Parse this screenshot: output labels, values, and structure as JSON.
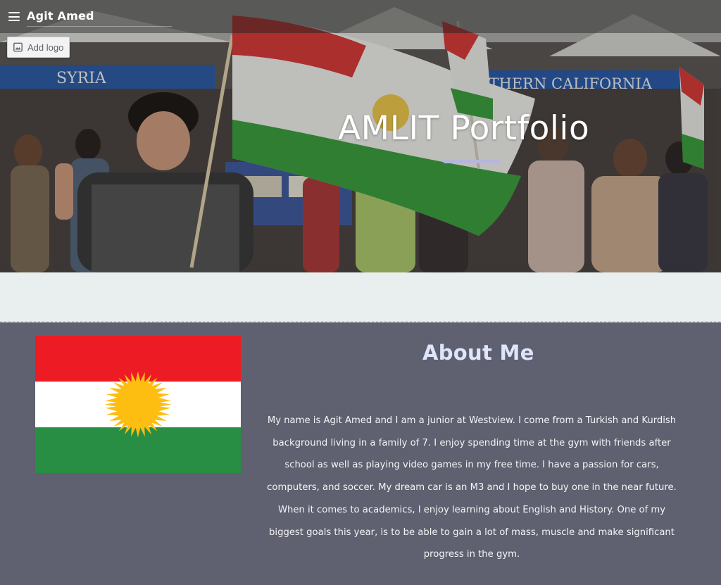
{
  "header": {
    "site_title": "Agit Amed",
    "add_logo_label": "Add logo"
  },
  "hero": {
    "title": "AMLIT Portfolio",
    "banner_left": "SYRIA",
    "banner_right": "COMMUNITY  SOUTHERN CALIFORNIA"
  },
  "about": {
    "heading": "About Me",
    "paragraph": "My name is Agit Amed and I am a junior at Westview. I come from a Turkish and Kurdish background living in a family of 7. I enjoy spending time at the gym with friends after school as well as playing video games in my free time. I have a passion for cars, computers, and soccer. My dream car is an M3 and I hope to buy one in the near future. When it comes to academics, I enjoy learning about English and History. One of my biggest goals this year, is to be able to gain a lot of mass, muscle and make significant progress in the gym."
  },
  "colors": {
    "section_bg": "#5f6070",
    "band_bg": "#e8efee",
    "heading": "#dfe6fb",
    "accent_rule": "#b6b6dc",
    "flag_red": "#ed1c24",
    "flag_white": "#ffffff",
    "flag_green": "#278e43",
    "flag_sun": "#febd11"
  },
  "icons": {
    "menu": "hamburger-menu-icon",
    "add_logo": "image-icon"
  }
}
